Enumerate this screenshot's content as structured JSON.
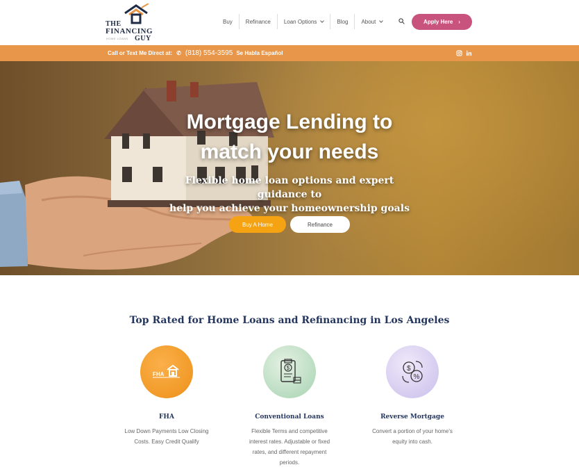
{
  "brand": {
    "line1": "THE",
    "line2": "FINANCING",
    "line3": "GUY",
    "tagline": "HOME LOANS"
  },
  "nav": {
    "items": [
      {
        "label": "Buy",
        "dropdown": false
      },
      {
        "label": "Refinance",
        "dropdown": false
      },
      {
        "label": "Loan Options",
        "dropdown": true
      },
      {
        "label": "Blog",
        "dropdown": false
      },
      {
        "label": "About",
        "dropdown": true
      }
    ],
    "search_icon": "search-icon",
    "apply_label": "Apply Here"
  },
  "topbar": {
    "contact_label": "Call or Text Me Direct at:",
    "phone": "(818) 554-3595",
    "spanish": "Se Habla Español",
    "social_icons": [
      "instagram-icon",
      "linkedin-icon"
    ]
  },
  "hero": {
    "title_line1": "Mortgage Lending to",
    "title_line2": "match your needs",
    "subtitle_line1": "Flexible home loan options and expert guidance to",
    "subtitle_line2": "help you achieve your homeownership goals",
    "buy_label": "Buy A Home",
    "refi_label": "Refinance"
  },
  "services": {
    "title": "Top Rated for Home Loans and Refinancing in Los Angeles",
    "cards": [
      {
        "title": "FHA",
        "icon_text": "FHA",
        "desc_lines": [
          "Low Down Payments Low Closing",
          "Costs. Easy Credit Qualify"
        ]
      },
      {
        "title": "Conventional Loans",
        "icon_text": "$",
        "desc_lines": [
          "Flexible Terms and competitive",
          "interest rates.  Adjustable or fixed",
          "rates, and different repayment",
          "periods."
        ]
      },
      {
        "title": "Reverse  Mortgage",
        "icon_text": "%",
        "desc_lines": [
          "Convert a portion of your home's",
          "equity into cash."
        ]
      }
    ]
  },
  "colors": {
    "accent_orange": "#e8964a",
    "apply_pink": "#c8547e",
    "buy_orange": "#f5a213",
    "navy": "#24365e"
  }
}
